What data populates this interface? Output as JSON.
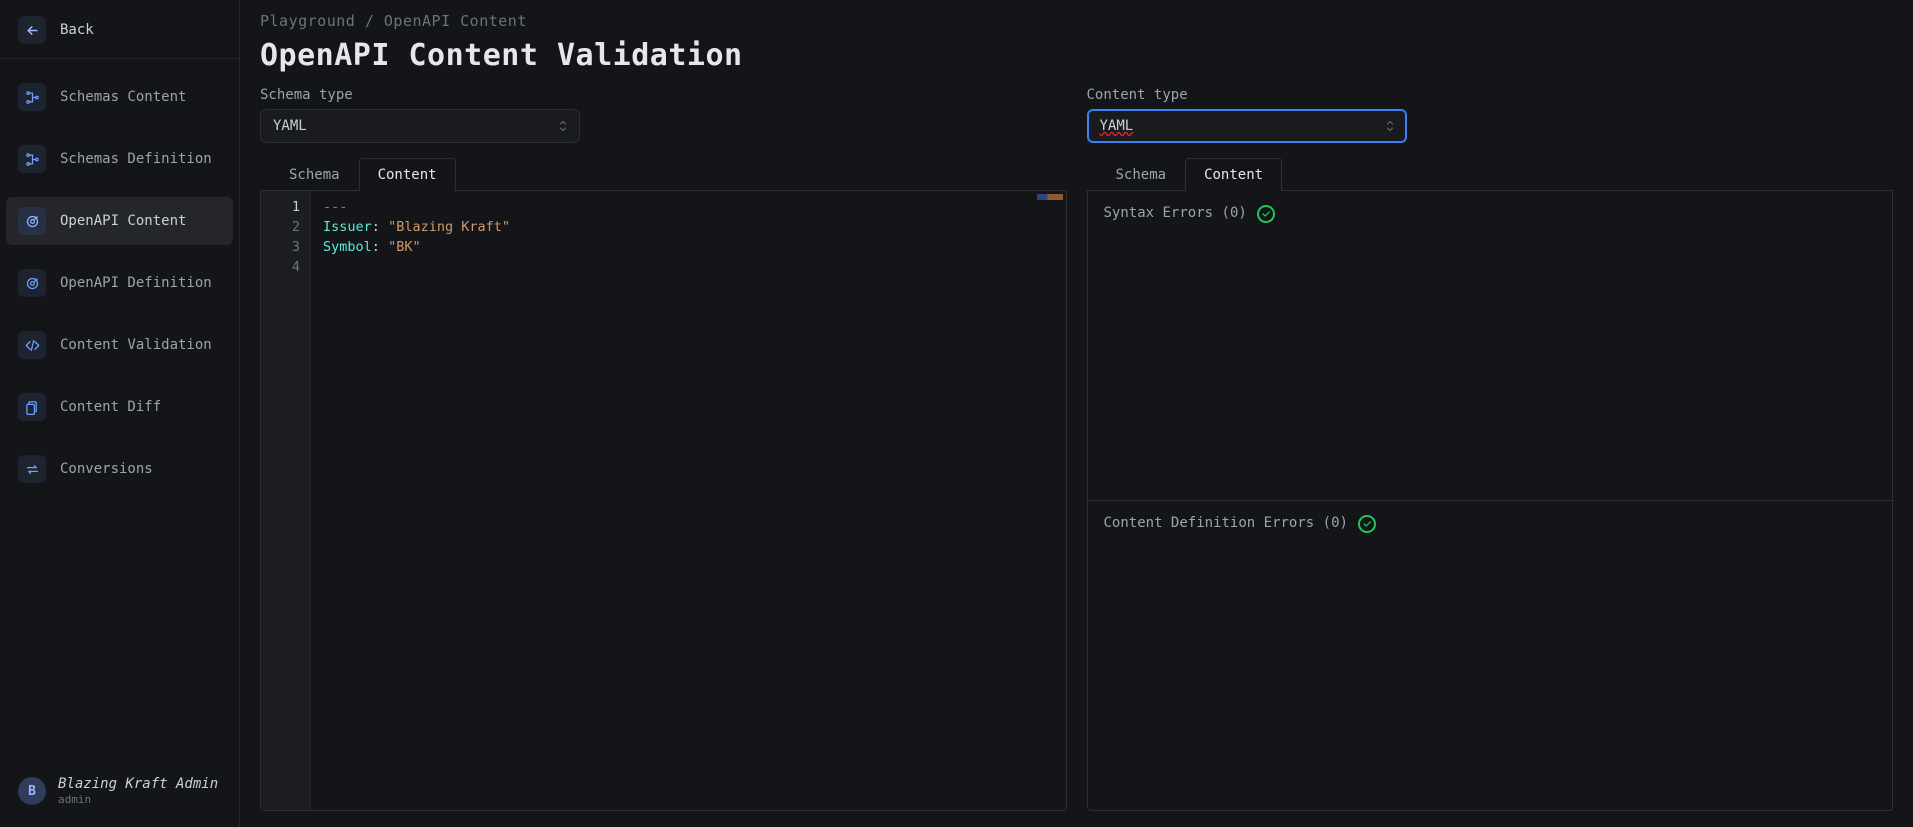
{
  "sidebar": {
    "back_label": "Back",
    "items": [
      {
        "label": "Schemas Content",
        "icon": "tree"
      },
      {
        "label": "Schemas Definition",
        "icon": "tree"
      },
      {
        "label": "OpenAPI Content",
        "icon": "target",
        "active": true
      },
      {
        "label": "OpenAPI Definition",
        "icon": "target"
      },
      {
        "label": "Content Validation",
        "icon": "code"
      },
      {
        "label": "Content Diff",
        "icon": "diff"
      },
      {
        "label": "Conversions",
        "icon": "swap"
      }
    ],
    "user": {
      "initial": "B",
      "name": "Blazing Kraft Admin",
      "role": "admin"
    }
  },
  "breadcrumb": {
    "parts": [
      "Playground",
      "OpenAPI Content"
    ],
    "separator": " / "
  },
  "page_title": "OpenAPI Content Validation",
  "left": {
    "field_label": "Schema type",
    "select_value": "YAML",
    "tabs": [
      "Schema",
      "Content"
    ],
    "active_tab": "Content",
    "editor": {
      "lines": [
        "1",
        "2",
        "3",
        "4"
      ],
      "code": {
        "l1_dashes": "---",
        "l2_key": "Issuer",
        "l2_colon": ":",
        "l2_val": "\"Blazing Kraft\"",
        "l3_key": "Symbol",
        "l3_colon": ":",
        "l3_val": "\"BK\""
      }
    }
  },
  "right": {
    "field_label": "Content type",
    "select_value": "YAML",
    "select_focused": true,
    "tabs": [
      "Schema",
      "Content"
    ],
    "active_tab": "Content",
    "errors": {
      "syntax": {
        "title": "Syntax Errors",
        "count": 0
      },
      "content": {
        "title": "Content Definition Errors",
        "count": 0
      }
    }
  },
  "colors": {
    "accent": "#3b82f6",
    "ok": "#22c55e"
  }
}
